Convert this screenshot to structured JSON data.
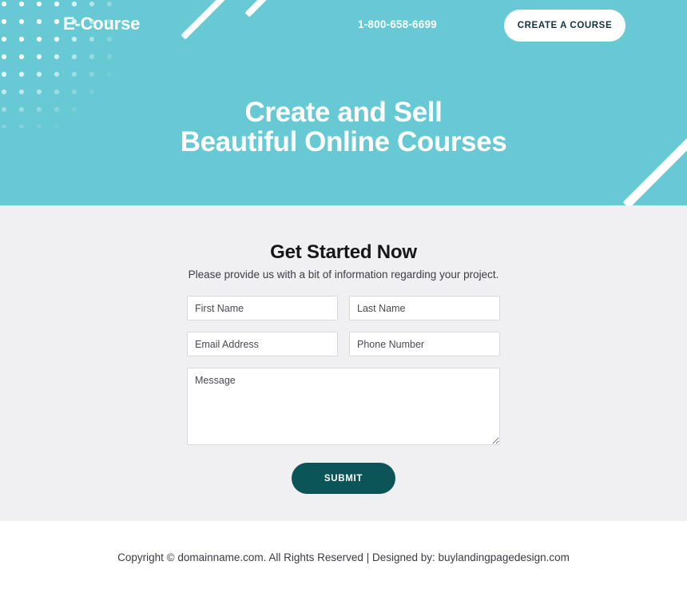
{
  "colors": {
    "hero_bg": "#67c9d3",
    "form_bg": "#f0eff1",
    "footer_bg": "#ffffff",
    "cta_bg": "#ffffff",
    "cta_text": "#12323d",
    "submit_bg": "#0b5559",
    "submit_text": "#ffffff",
    "heading_text": "#ffffff",
    "form_title_text": "#16151a",
    "input_border": "#d9d9dd",
    "decoration": "#ffffff"
  },
  "header": {
    "logo": "E-Course",
    "phone": "1-800-658-6699",
    "cta_label": "CREATE A COURSE"
  },
  "hero": {
    "heading_line1": "Create and Sell",
    "heading_line2": "Beautiful Online Courses"
  },
  "form": {
    "title": "Get Started Now",
    "subtitle": "Please provide us with a bit of information regarding your project.",
    "fields": [
      {
        "name": "first-name",
        "placeholder": "First Name",
        "value": ""
      },
      {
        "name": "last-name",
        "placeholder": "Last Name",
        "value": ""
      },
      {
        "name": "email-address",
        "placeholder": "Email Address",
        "value": ""
      },
      {
        "name": "phone-number",
        "placeholder": "Phone Number",
        "value": ""
      }
    ],
    "message_placeholder": "Message",
    "message_value": "",
    "submit_label": "SUBMIT"
  },
  "footer": {
    "copyright": "Copyright © domainname.com. All Rights Reserved | Designed by: buylandingpagedesign.com"
  }
}
